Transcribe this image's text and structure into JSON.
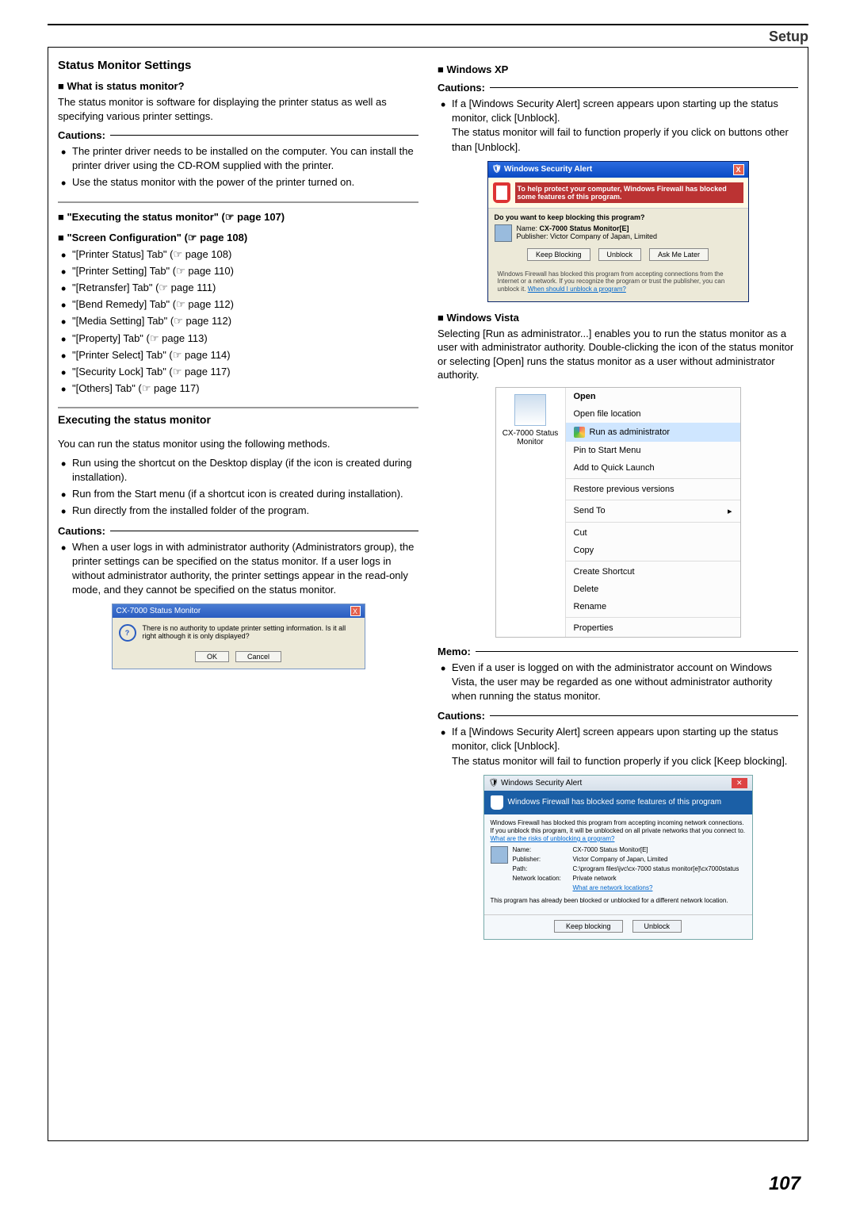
{
  "header": "Setup",
  "page_number": "107",
  "left": {
    "title": "Status Monitor Settings",
    "what_is_h": "What is status monitor?",
    "what_is_b": "The status monitor is software for displaying the printer status as well as specifying various printer settings.",
    "caution1_label": "Cautions:",
    "caution1_items": [
      "The printer driver needs to be installed on the computer. You can install the printer driver using the CD-ROM supplied with the printer.",
      "Use the status monitor with the power of the printer turned on."
    ],
    "exec_link": "\"Executing the status monitor\" (☞ page 107)",
    "screen_link": "\"Screen Configuration\" (☞ page 108)",
    "tabs": [
      "\"[Printer Status] Tab\" (☞ page 108)",
      "\"[Printer Setting] Tab\" (☞ page 110)",
      "\"[Retransfer] Tab\" (☞ page 111)",
      "\"[Bend Remedy] Tab\" (☞ page 112)",
      "\"[Media Setting] Tab\" (☞ page 112)",
      "\"[Property] Tab\" (☞ page 113)",
      "\"[Printer Select] Tab\" (☞ page 114)",
      "\"[Security Lock] Tab\" (☞ page 117)",
      "\"[Others] Tab\" (☞ page 117)"
    ],
    "exec_h": "Executing the status monitor",
    "exec_b": "You can run the status monitor using the following methods.",
    "exec_items": [
      "Run using the shortcut on the Desktop display (if the icon is created during installation).",
      "Run from the Start menu (if a shortcut icon is created during installation).",
      "Run directly from the installed folder of the program."
    ],
    "caution2_label": "Cautions:",
    "caution2_items": [
      "When a user logs in with administrator authority (Administrators group), the printer settings can be specified on the status monitor. If a user logs in without administrator authority, the printer settings appear in the read-only mode, and they cannot be specified on the status monitor."
    ],
    "cx": {
      "title": "CX-7000 Status Monitor",
      "msg": "There is no authority to update printer setting information. Is it all right although it is only displayed?",
      "ok": "OK",
      "cancel": "Cancel"
    }
  },
  "right": {
    "xp_h": "Windows XP",
    "caution1_label": "Cautions:",
    "caution1_items": [
      "If a [Windows Security Alert] screen appears upon starting up the status monitor, click [Unblock].\nThe status monitor will fail to function properly if you click on buttons other than [Unblock]."
    ],
    "xp": {
      "title": "Windows Security Alert",
      "warn": "To help protect your computer, Windows Firewall has blocked some features of this program.",
      "q": "Do you want to keep blocking this program?",
      "name_l": "Name:",
      "name_v": "CX-7000 Status Monitor[E]",
      "pub_l": "Publisher:",
      "pub_v": "Victor Company of Japan, Limited",
      "b1": "Keep Blocking",
      "b2": "Unblock",
      "b3": "Ask Me Later",
      "foot": "Windows Firewall has blocked this program from accepting connections from the Internet or a network. If you recognize the program or trust the publisher, you can unblock it. ",
      "foot_link": "When should I unblock a program?"
    },
    "vista_h": "Windows Vista",
    "vista_b": "Selecting [Run as administrator...] enables you to run the status monitor as a user with administrator authority. Double-clicking the icon of the status monitor or selecting [Open] runs the status monitor as a user without administrator authority.",
    "vista_label": "CX-7000 Status Monitor",
    "vista_menu": [
      {
        "t": "Open",
        "bold": true
      },
      {
        "t": "Open file location"
      },
      {
        "t": "Run as administrator",
        "shield": true,
        "sel": true
      },
      {
        "t": "Pin to Start Menu"
      },
      {
        "t": "Add to Quick Launch"
      },
      {
        "sep": true
      },
      {
        "t": "Restore previous versions"
      },
      {
        "sep": true
      },
      {
        "t": "Send To",
        "arrow": true
      },
      {
        "sep": true
      },
      {
        "t": "Cut"
      },
      {
        "t": "Copy"
      },
      {
        "sep": true
      },
      {
        "t": "Create Shortcut"
      },
      {
        "t": "Delete"
      },
      {
        "t": "Rename"
      },
      {
        "sep": true
      },
      {
        "t": "Properties"
      }
    ],
    "memo_label": "Memo:",
    "memo_items": [
      "Even if a user is logged on with the administrator account on Windows Vista, the user may be regarded as one without administrator authority when running the status monitor."
    ],
    "caution2_label": "Cautions:",
    "caution2_items": [
      "If a [Windows Security Alert] screen appears upon starting up the status monitor, click [Unblock].\nThe status monitor will fail to function properly if you click [Keep blocking]."
    ],
    "va": {
      "title": "Windows Security Alert",
      "bar": "Windows Firewall has blocked some features of this program",
      "lead": "Windows Firewall has blocked this program from accepting incoming network connections. If you unblock this program, it will be unblocked on all private networks that you connect to. ",
      "lead_link": "What are the risks of unblocking a program?",
      "name_l": "Name:",
      "name_v": "CX-7000 Status Monitor[E]",
      "pub_l": "Publisher:",
      "pub_v": "Victor Company of Japan, Limited",
      "path_l": "Path:",
      "path_v": "C:\\program files\\jvc\\cx-7000 status monitor[e]\\cx7000status",
      "net_l": "Network location:",
      "net_v": "Private network",
      "net_link": "What are network locations?",
      "foot": "This program has already been blocked or unblocked for a different network location.",
      "b1": "Keep blocking",
      "b2": "Unblock"
    }
  }
}
